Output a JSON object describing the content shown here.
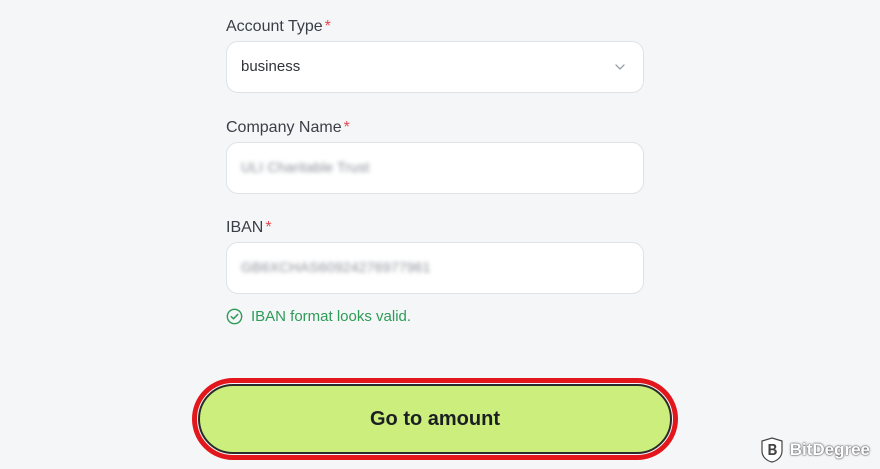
{
  "form": {
    "account_type": {
      "label": "Account Type",
      "required_mark": "*",
      "value": "business"
    },
    "company_name": {
      "label": "Company Name",
      "required_mark": "*",
      "value": "ULI Charitable Trust"
    },
    "iban": {
      "label": "IBAN",
      "required_mark": "*",
      "value": "GB6XCHAS60924276977961",
      "validation_message": "IBAN format looks valid."
    }
  },
  "cta": {
    "label": "Go to amount",
    "background": "#cbee7c",
    "highlight_color": "#e3161c"
  },
  "watermark": {
    "text": "BitDegree"
  }
}
